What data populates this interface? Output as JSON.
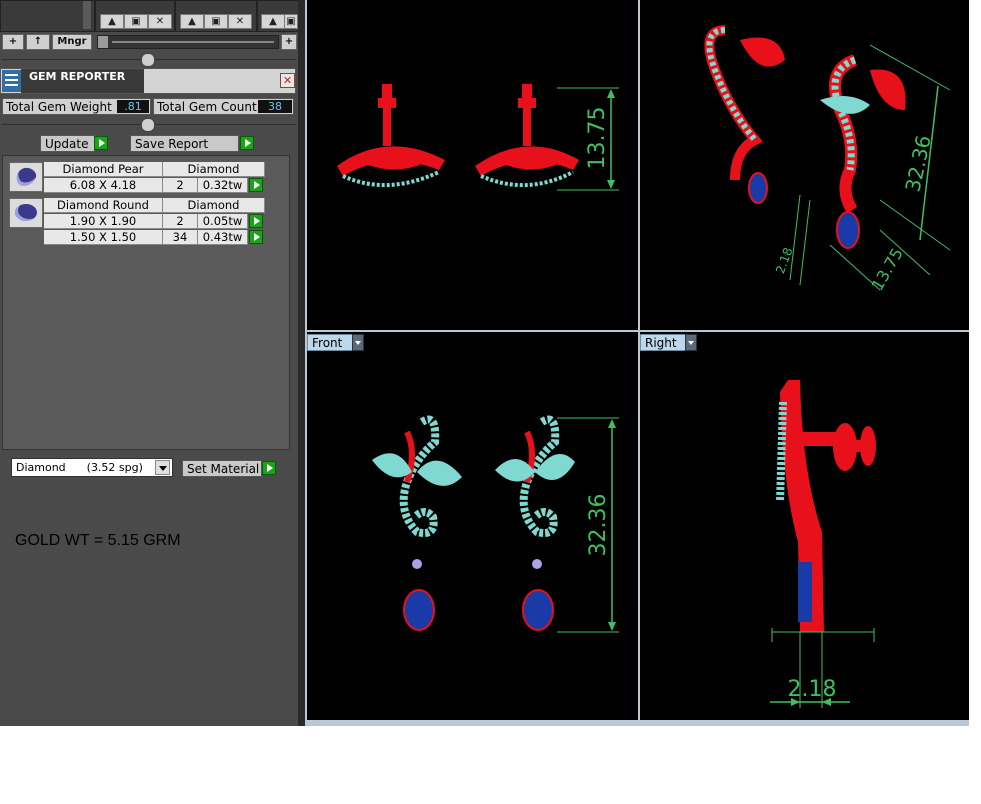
{
  "toolbar": {
    "add_label": "+",
    "up_label": "↑",
    "mngr_label": "Mngr",
    "plus_right_label": "+"
  },
  "gem_reporter": {
    "title": "GEM REPORTER",
    "total_weight_label": "Total Gem Weight",
    "total_weight_value": ".81",
    "total_count_label": "Total Gem Count",
    "total_count_value": "38",
    "update_label": "Update",
    "save_report_label": "Save Report",
    "groups": [
      {
        "name": "Diamond Pear",
        "material": "Diamond",
        "rows": [
          {
            "size": "6.08 X 4.18",
            "count": "2",
            "weight": "0.32tw"
          }
        ]
      },
      {
        "name": "Diamond Round",
        "material": "Diamond",
        "rows": [
          {
            "size": "1.90 X 1.90",
            "count": "2",
            "weight": "0.05tw"
          },
          {
            "size": "1.50 X 1.50",
            "count": "34",
            "weight": "0.43tw"
          }
        ]
      }
    ],
    "material_select": "Diamond      (3.52 spg)",
    "set_material_label": "Set Material"
  },
  "note": "GOLD WT = 5.15 GRM",
  "viewports": {
    "front_tab": "Front",
    "right_tab": "Right",
    "top_dim": "13.75",
    "persp_dim_a": "32.36",
    "persp_dim_b": "13.75",
    "persp_dim_c": "2.18",
    "front_dim": "32.36",
    "right_dim": "2.18"
  },
  "colors": {
    "metal": "#e8101a",
    "diamond": "#7fd9d0",
    "sapphire": "#1a3aa8",
    "dimension": "#3fbf63",
    "viewport_bg": "#000000",
    "panel_bg": "#4a4a4a"
  }
}
